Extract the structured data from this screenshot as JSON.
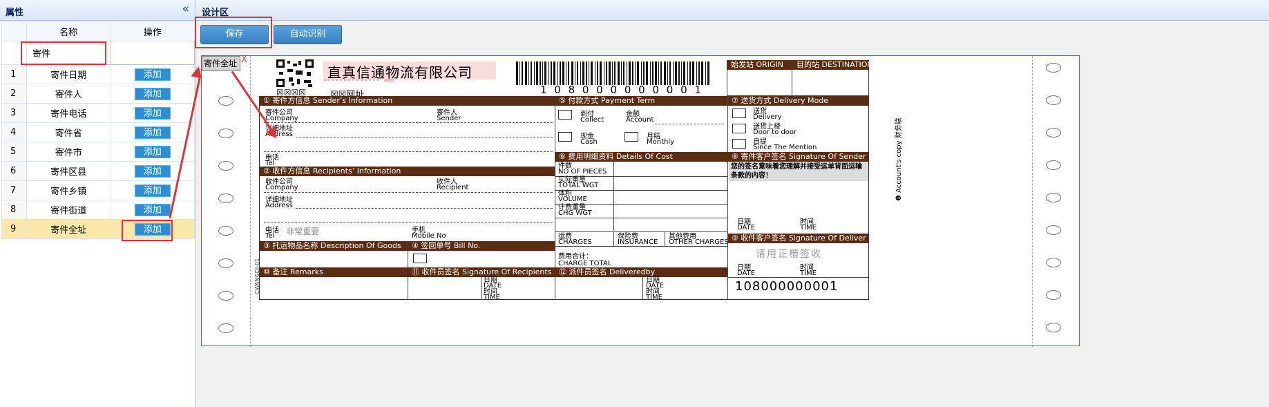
{
  "left_panel": {
    "title": "属性",
    "collapse_icon": "«",
    "col_name": "名称",
    "col_op": "操作",
    "search_value": "寄件",
    "add_label": "添加",
    "rows": [
      {
        "num": "1",
        "name": "寄件日期"
      },
      {
        "num": "2",
        "name": "寄件人"
      },
      {
        "num": "3",
        "name": "寄件电话"
      },
      {
        "num": "4",
        "name": "寄件省"
      },
      {
        "num": "5",
        "name": "寄件市"
      },
      {
        "num": "6",
        "name": "寄件区县"
      },
      {
        "num": "7",
        "name": "寄件乡镇"
      },
      {
        "num": "8",
        "name": "寄件街道"
      },
      {
        "num": "9",
        "name": "寄件全址"
      }
    ]
  },
  "design": {
    "title": "设计区",
    "save_label": "保存",
    "auto_label": "自动识别",
    "field_tag": "寄件全址",
    "close_x": "X"
  },
  "waybill": {
    "company": "直真信通物流有限公司",
    "boxes_left": "☒☒☒☒",
    "boxes_right": "☒☒网址",
    "barcode_number": "1 0 8 0 0 0 0 0 0 0 0 1",
    "origin": "始发站 ORIGIN",
    "destination": "目的站 DESTINATION",
    "sender_bar": "① 寄件方信息  Sender’s Information",
    "payment_bar": "⑤ 付款方式  Payment Term",
    "delivery_bar": "⑦ 送货方式  Delivery Mode",
    "s_company_cn": "寄件公司",
    "s_company_en": "Company",
    "s_sender_cn": "寄件人",
    "s_sender_en": "Sender",
    "s_addr_cn": "详细地址",
    "s_addr_en": "Address",
    "s_tel_cn": "电话",
    "s_tel_en": "Tel",
    "collect_cn": "到付",
    "collect_en": "Collect",
    "account_cn": "金额",
    "account_en": "Account",
    "cash_cn": "现金",
    "cash_en": "Cash",
    "monthly_cn": "月结",
    "monthly_en": "Monthly",
    "deliv_cn": "送货",
    "deliv_en": "Delivery",
    "door_cn": "送货上楼",
    "door_en": "Door to door",
    "self_cn": "自提",
    "self_en": "Since The Mention",
    "recip_bar": "② 收件方信息  Recipients’ Information",
    "cost_bar": "⑥ 费用明细资料   Details Of Cost",
    "sig_sender_bar": "⑧ 寄件客户签名  Signature Of Sender",
    "r_company_cn": "收件公司",
    "r_company_en": "Company",
    "r_recip_cn": "收件人",
    "r_recip_en": "Recipient",
    "r_addr_cn": "详细地址",
    "r_addr_en": "Address",
    "r_tel_cn": "电话",
    "r_tel_en": "Tel",
    "r_tel_val": "非常重要",
    "r_mobile_cn": "手机",
    "r_mobile_en": "Mobile No",
    "pieces_cn": "件数",
    "pieces_en": "NO OF PIECES",
    "wgt_cn": "实际重量",
    "wgt_en": "TOTAL WGT",
    "vol_cn": "体积",
    "vol_en": "VOLUME",
    "chg_cn": "计费重量",
    "chg_en": "CHG WGT",
    "charges_cn": "运费",
    "charges_en": "CHARGES",
    "ins_cn": "保险费",
    "ins_en": "INSURANCE",
    "other_cn": "其他费用",
    "other_en": "OTHER CHARGES",
    "sig_text": "您的签名意味着您理解并接受运单背面运输条款的内容！",
    "date_cn": "日期",
    "date_en": "DATE",
    "time_cn": "时间",
    "time_en": "TIME",
    "goods_bar": "③ 托运物品名称  Description Of Goods",
    "bill_bar": "④ 签回单号  Bill No.",
    "total_cn": "费用合计：",
    "total_en": "CHARGE TOTAL",
    "sig_deliver_bar": "⑨ 收件客户签名  Signature Of Deliver",
    "sign_hint": "请用正楷签收",
    "remarks_bar": "⑩ 备注  Remarks",
    "sig_recip_bar": "⑪ 收件员签名  Signature Of Recipients",
    "delivered_bar": "⑫ 派件员签名  Deliveredby",
    "bottom_number": "108000000001",
    "side_text": "❶ Account's copy 财务联",
    "form_code": "CWANGDI-01"
  }
}
